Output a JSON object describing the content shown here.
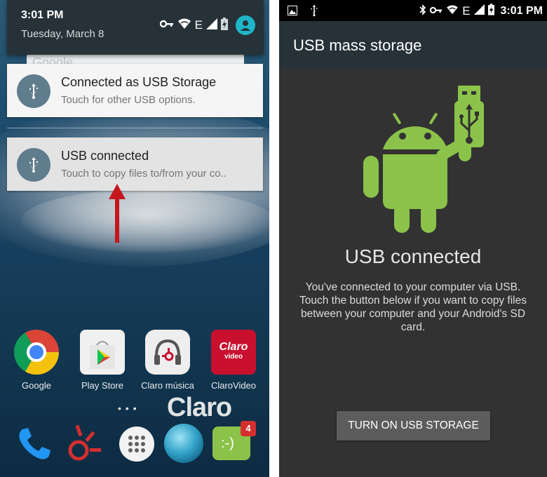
{
  "left_screen": {
    "shade": {
      "time": "3:01 PM",
      "date": "Tuesday, March 8",
      "network_type": "E",
      "icons": [
        "key-icon",
        "wifi-icon",
        "signal-icon",
        "battery-icon",
        "user-avatar-icon"
      ]
    },
    "notifications": [
      {
        "icon": "usb-icon",
        "title": "Connected as USB Storage",
        "text": "Touch for other USB options."
      },
      {
        "icon": "usb-icon",
        "title": "USB connected",
        "text": "Touch to copy files to/from your co.."
      }
    ],
    "annotation": {
      "arrow_color": "#c4161c"
    },
    "apps": [
      {
        "label": "Google",
        "icon": "chrome-icon"
      },
      {
        "label": "Play Store",
        "icon": "play-store-icon"
      },
      {
        "label": "Claro música",
        "icon": "claro-musica-icon"
      },
      {
        "label": "ClaroVideo",
        "icon": "claro-video-icon"
      }
    ],
    "claro_video_icon_text": [
      "Claro",
      "video"
    ],
    "carrier_logo": "Claro",
    "google_peek": "Google",
    "dock": [
      {
        "icon": "phone-icon"
      },
      {
        "icon": "claro-icon"
      },
      {
        "icon": "app-drawer-icon"
      },
      {
        "icon": "globe-icon"
      },
      {
        "icon": "messaging-icon",
        "badge": "4"
      }
    ]
  },
  "right_screen": {
    "status_bar": {
      "time": "3:01 PM",
      "network_type": "E",
      "left_icons": [
        "image-icon",
        "usb-icon"
      ],
      "right_icons": [
        "bluetooth-icon",
        "key-icon",
        "wifi-icon",
        "signal-icon",
        "battery-icon"
      ]
    },
    "action_bar_title": "USB mass storage",
    "heading": "USB connected",
    "description": "You've connected to your computer via USB. Touch the button below if you want to copy files between your computer and your Android's SD card.",
    "button_label": "TURN ON USB STORAGE"
  },
  "colors": {
    "android_green": "#8bc34a",
    "action_bar": "#263238",
    "annotation_red": "#c4161c",
    "usb_icon_bg": "#5f7d8d"
  }
}
